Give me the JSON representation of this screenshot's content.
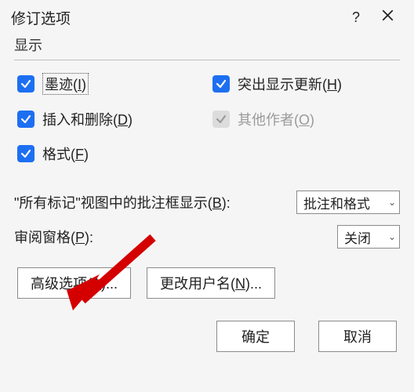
{
  "titlebar": {
    "title": "修订选项",
    "help": "?",
    "close_icon": "close"
  },
  "section": {
    "display_label": "显示"
  },
  "checks": {
    "ink": {
      "label": "墨迹(I)",
      "checked": true,
      "focused": true
    },
    "highlight": {
      "label": "突出显示更新(H)",
      "checked": true
    },
    "insdel": {
      "label": "插入和删除(D)",
      "checked": true
    },
    "others": {
      "label": "其他作者(O)",
      "checked": true,
      "disabled": true
    },
    "format": {
      "label": "格式(F)",
      "checked": true
    }
  },
  "rows": {
    "balloons": {
      "label": "\"所有标记\"视图中的批注框显示(B):",
      "value": "批注和格式"
    },
    "pane": {
      "label": "审阅窗格(P):",
      "value": "关闭"
    }
  },
  "buttons": {
    "advanced": "高级选项(A)...",
    "changeuser": "更改用户名(N)...",
    "ok": "确定",
    "cancel": "取消"
  }
}
